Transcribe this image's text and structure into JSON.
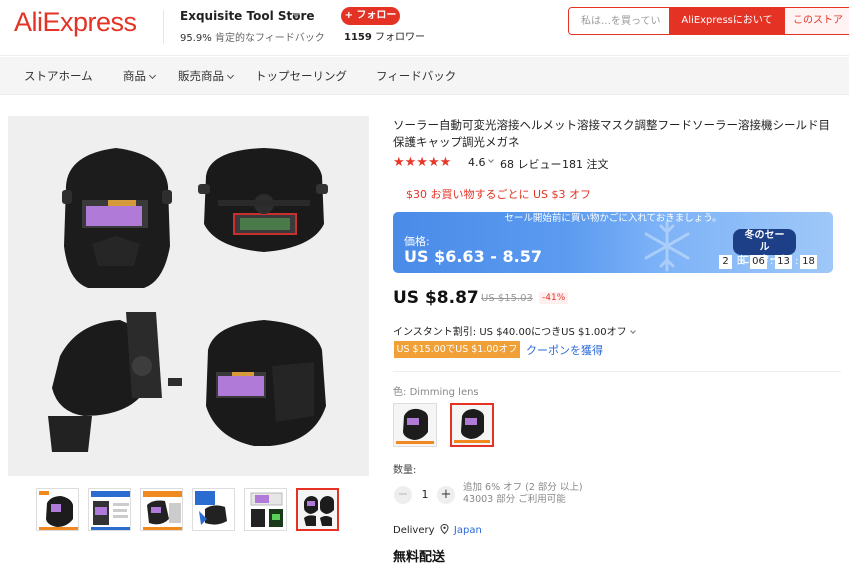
{
  "header": {
    "logo": "AliExpress",
    "store_name": "Exquisite Tool Store",
    "feedback_pct": "95.9%",
    "feedback_label": "肯定的なフィードバック",
    "follow_label": "+ フォロー",
    "followers_count": "1159",
    "followers_label": "フォロワー",
    "search_placeholder": "私は…を買ってい",
    "search_all_label": "AliExpressにおいて",
    "search_store_label": "このストア"
  },
  "nav": {
    "items": [
      {
        "label": "ストアホーム",
        "has_caret": false
      },
      {
        "label": "商品",
        "has_caret": true
      },
      {
        "label": "販売商品",
        "has_caret": true
      },
      {
        "label": "トップセーリング",
        "has_caret": false
      },
      {
        "label": "フィードバック",
        "has_caret": false
      }
    ]
  },
  "product": {
    "title": "ソーラー自動可変光溶接ヘルメット溶接マスク調整フードソーラー溶接機シールド目保護キャップ調光メガネ",
    "rating": "4.6",
    "reviews": "68 レビュー",
    "orders": "181 注文",
    "promo": "$30 お買い物するごとに US $3 オフ",
    "sale_banner": {
      "top_text": "セール開始前に買い物かごに入れておきましょう。",
      "price_label": "価格:",
      "price_range": "US $6.63 - 8.57",
      "badge_line1": "冬のセール",
      "badge_line2": "にスタート",
      "countdown": {
        "days": "2",
        "day_unit": "日",
        "hours": "06",
        "minutes": "13",
        "seconds": "18"
      }
    },
    "price_now": "US $8.87",
    "price_old": "US $15.03",
    "discount": "-41%",
    "instant_discount": "インスタント割引: US $40.00につきUS $1.00オフ",
    "coupon_tag": "US $15.00でUS $1.00オフ",
    "coupon_link": "クーポンを獲得",
    "color_label": "色:",
    "color_value": "Dimming lens",
    "quantity_label": "数量:",
    "quantity": "1",
    "qty_info_line1": "追加 6% オフ (2 部分 以上)",
    "qty_info_line2": "43003 部分 ご利用可能",
    "delivery_label": "Delivery",
    "delivery_location": "Japan",
    "free_shipping": "無料配送"
  },
  "colors": {
    "brand": "#e43225",
    "link": "#2a68d8",
    "coupon": "#f0a036",
    "banner": "#5c9bf0"
  }
}
